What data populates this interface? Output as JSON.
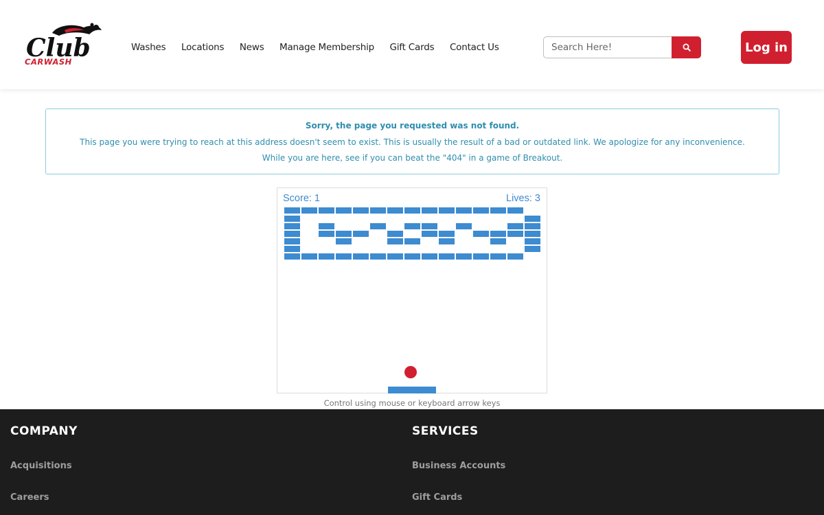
{
  "brand": {
    "logo_text": "Club",
    "logo_subtext": "CARWASH",
    "accent_color": "#d0202f"
  },
  "nav": {
    "items": [
      {
        "label": "Washes"
      },
      {
        "label": "Locations"
      },
      {
        "label": "News"
      },
      {
        "label": "Manage Membership"
      },
      {
        "label": "Gift Cards"
      },
      {
        "label": "Contact Us"
      }
    ]
  },
  "search": {
    "placeholder": "Search Here!",
    "value": "",
    "icon": "search-icon"
  },
  "login": {
    "label": "Log in"
  },
  "alert": {
    "title": "Sorry, the page you requested was not found.",
    "message": "This page you were trying to reach at this address doesn't seem to exist. This is usually the result of a bad or outdated link. We apologize for any inconvenience.",
    "invite": "While you are here, see if you can beat the \"404\" in a game of Breakout.",
    "color": "#2f8eae"
  },
  "game": {
    "score_label": "Score: 1",
    "lives_label": "Lives: 3",
    "brick_color": "#3d8bd0",
    "ball_color": "#d0202f",
    "hint": "Control using mouse or keyboard arrow keys"
  },
  "footer": {
    "company": {
      "heading": "COMPANY",
      "links": [
        "Acquisitions",
        "Careers"
      ]
    },
    "services": {
      "heading": "SERVICES",
      "links": [
        "Business Accounts",
        "Gift Cards"
      ]
    }
  }
}
